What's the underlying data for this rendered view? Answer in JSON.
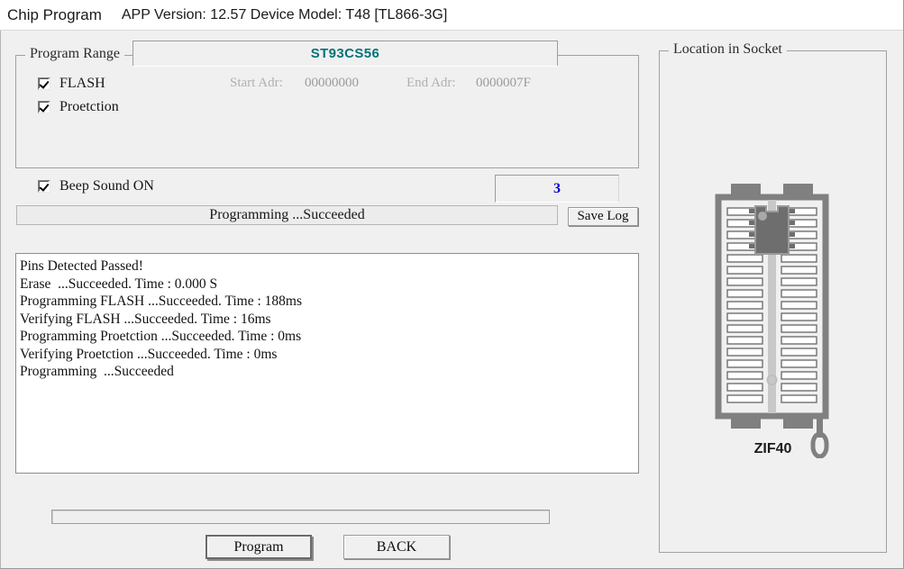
{
  "window": {
    "app_title": "Chip Program",
    "app_info": "APP Version: 12.57 Device Model: T48 [TL866-3G]"
  },
  "program_range": {
    "group_title": "Program Range",
    "chip_name": "ST93CS56",
    "chip_name_color": "#007377",
    "checkboxes": [
      {
        "label": "FLASH",
        "checked": true
      },
      {
        "label": "Proetction",
        "checked": true
      }
    ],
    "start_adr_label": "Start Adr:",
    "start_adr_value": "00000000",
    "end_adr_label": "End Adr:",
    "end_adr_value": "0000007F"
  },
  "beep": {
    "label": "Beep Sound ON",
    "checked": true
  },
  "counter": {
    "value": "3",
    "color": "#0000cc"
  },
  "status": {
    "text": "Programming  ...Succeeded"
  },
  "save_log_button": {
    "label": "Save Log"
  },
  "log": {
    "lines": [
      "Pins Detected Passed!",
      "Erase  ...Succeeded. Time : 0.000 S",
      "Programming FLASH ...Succeeded. Time : 188ms",
      "Verifying FLASH ...Succeeded. Time : 16ms",
      "Programming Proetction ...Succeeded. Time : 0ms",
      "Verifying Proetction ...Succeeded. Time : 0ms",
      "Programming  ...Succeeded"
    ]
  },
  "progress": {
    "percent": 0
  },
  "buttons": {
    "program": "Program",
    "back": "BACK"
  },
  "socket": {
    "group_title": "Location in Socket",
    "label": "ZIF40",
    "pin_count": 40,
    "rows_per_side": 20,
    "chip_pins_per_side": 4,
    "body_color": "#808080",
    "outline_color": "#808080"
  }
}
